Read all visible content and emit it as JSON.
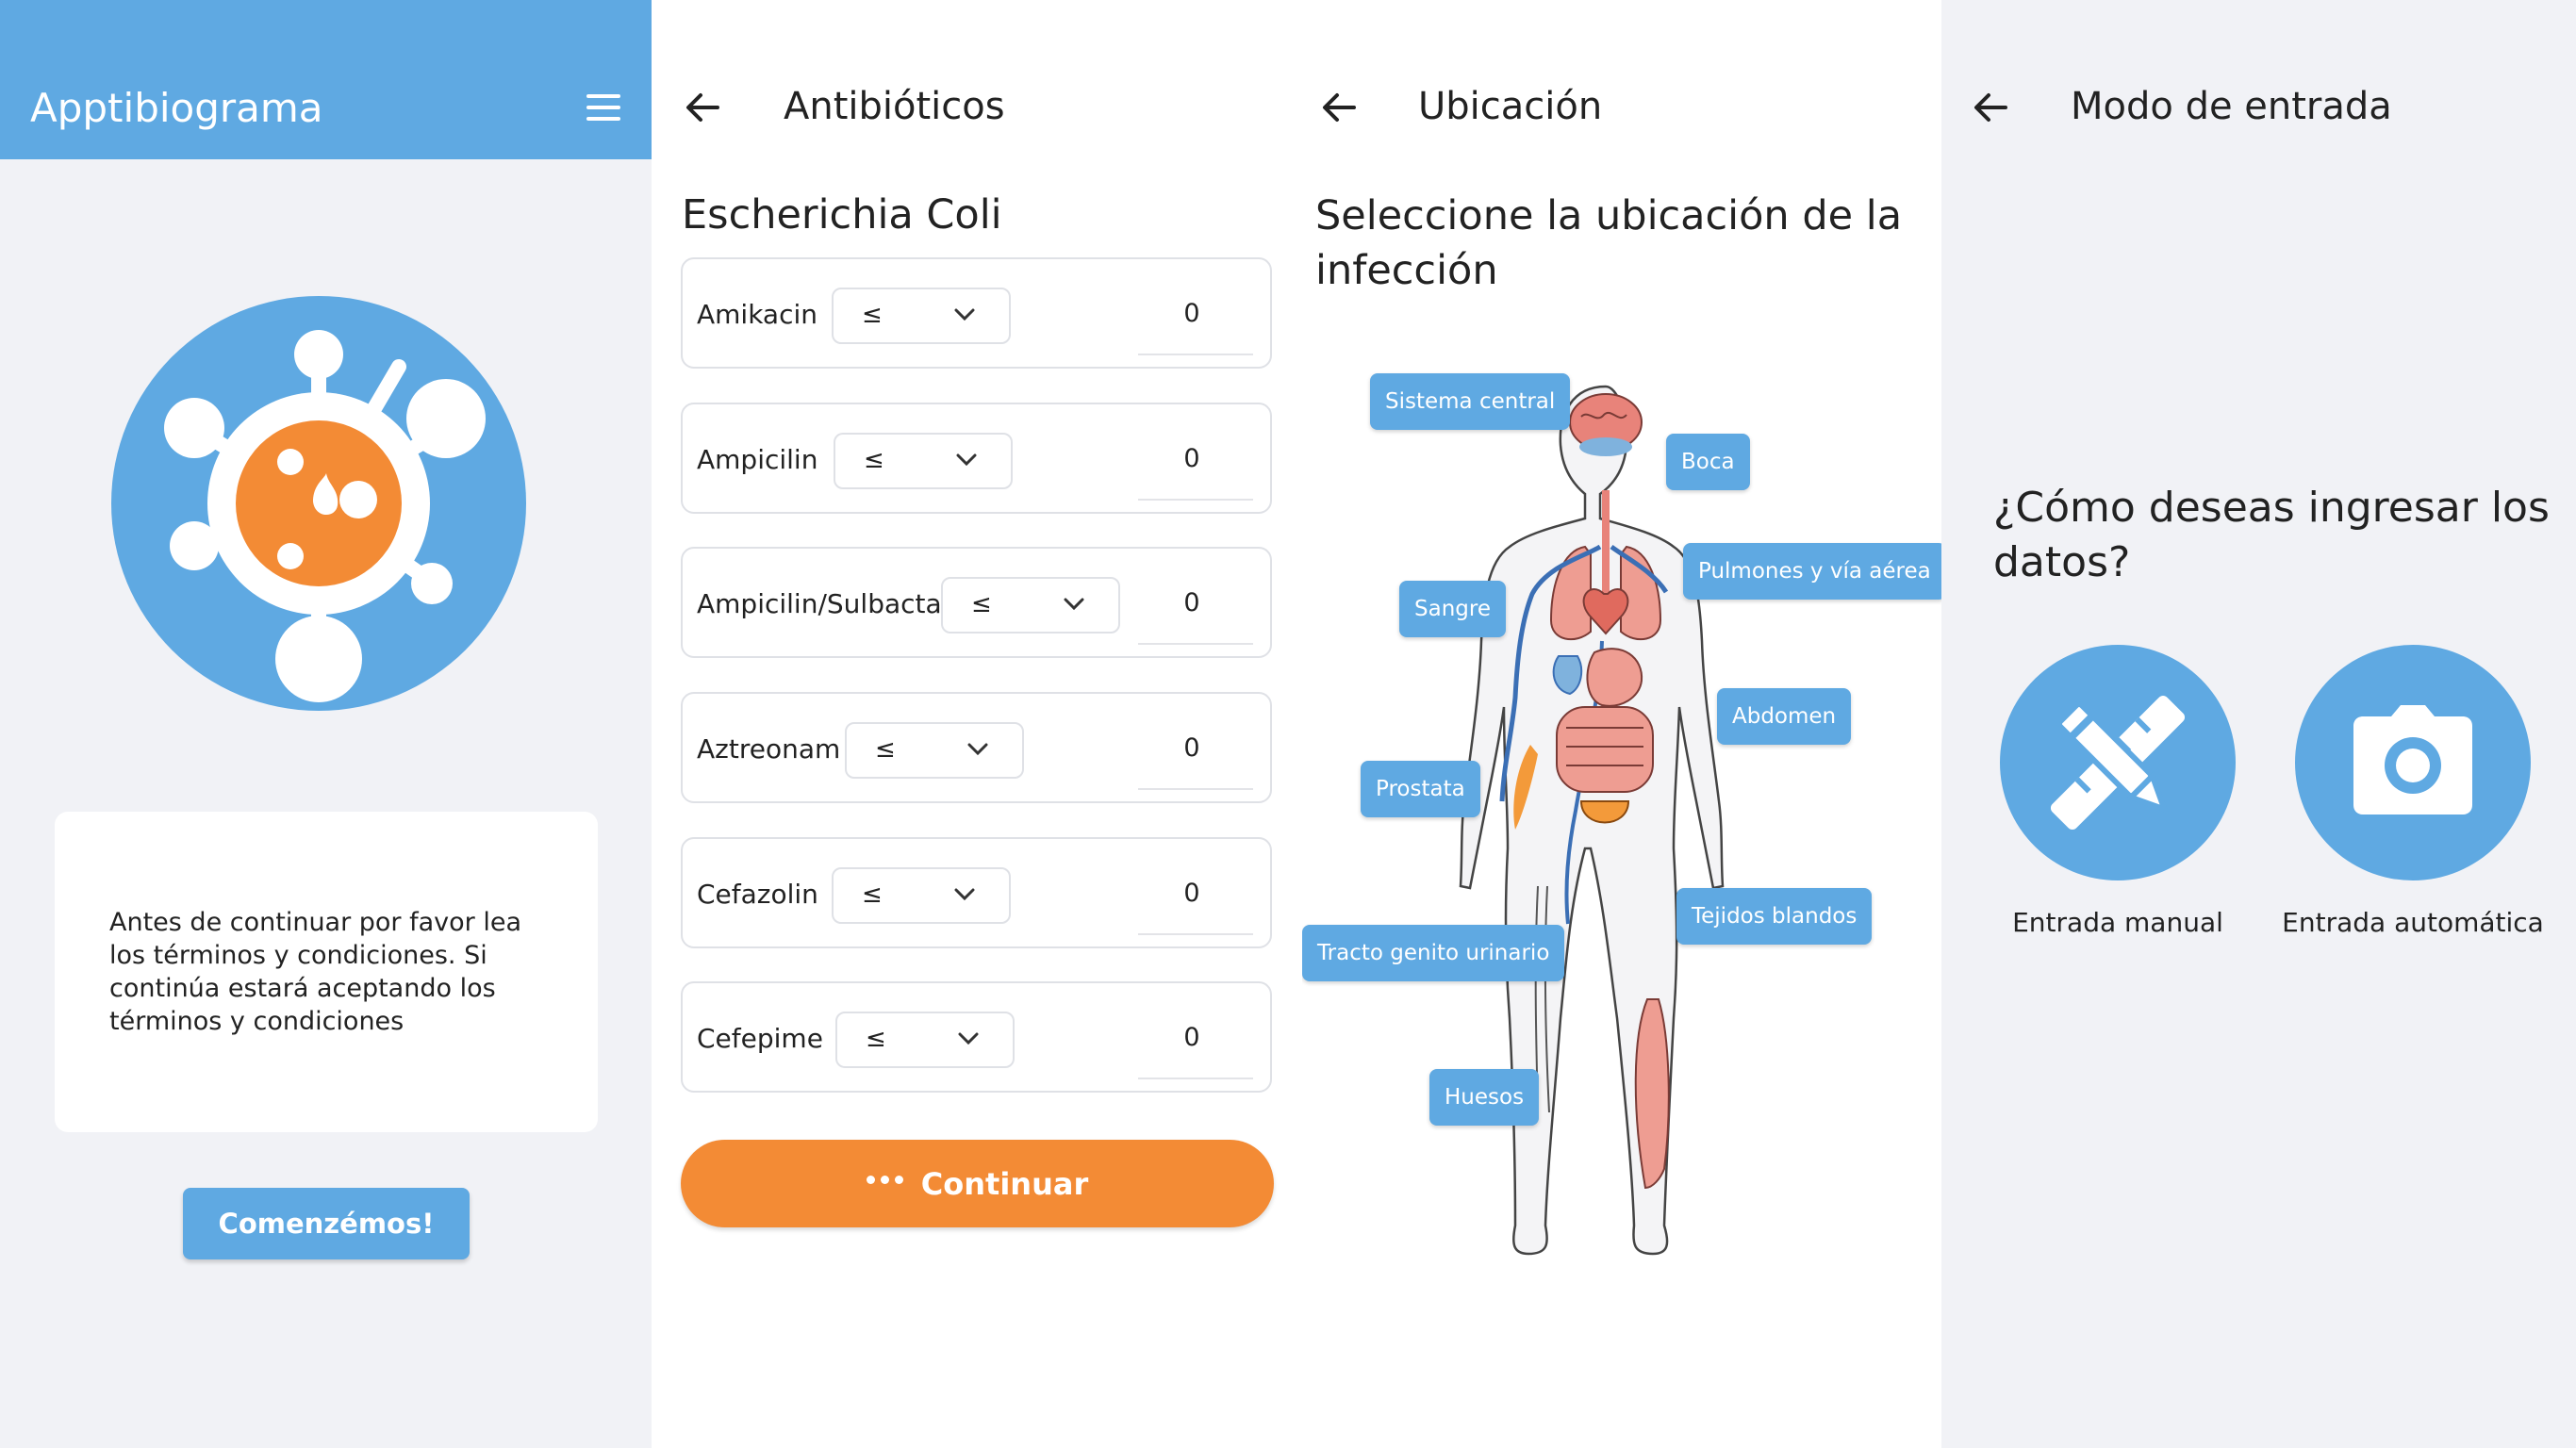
{
  "colors": {
    "primary": "#5fa9e2",
    "accent": "#f38b35",
    "background": "#f1f2f6"
  },
  "welcome": {
    "app_title": "Apptibiograma",
    "menu_icon": "hamburger-menu-icon",
    "logo_icon": "bacteria-logo-icon",
    "terms_text": "Antes de continuar por favor lea los términos y condiciones. Si continúa estará aceptando los términos y condiciones",
    "start_button": "Comenzémos!"
  },
  "antibiotics": {
    "title": "Antibióticos",
    "back_icon": "arrow-left-icon",
    "organism": "Escherichia Coli",
    "items": [
      {
        "name": "Amikacin",
        "operator": "≤",
        "value": "0"
      },
      {
        "name": "Ampicilin",
        "operator": "≤",
        "value": "0"
      },
      {
        "name": "Ampicilin/Sulbactan",
        "operator": "≤",
        "value": "0"
      },
      {
        "name": "Aztreonam",
        "operator": "≤",
        "value": "0"
      },
      {
        "name": "Cefazolin",
        "operator": "≤",
        "value": "0"
      },
      {
        "name": "Cefepime",
        "operator": "≤",
        "value": "0"
      }
    ],
    "continue_button": "Continuar",
    "continue_icon": "more-dots-icon"
  },
  "location": {
    "title": "Ubicación",
    "back_icon": "arrow-left-icon",
    "prompt": "Seleccione la ubicación de la infección",
    "illustration": "human-anatomy-illustration",
    "tags": {
      "sistema_central": "Sistema central",
      "boca": "Boca",
      "pulmones": "Pulmones y vía aérea",
      "sangre": "Sangre",
      "abdomen": "Abdomen",
      "prostata": "Prostata",
      "tejidos": "Tejidos blandos",
      "tracto": "Tracto genito urinario",
      "huesos": "Huesos"
    }
  },
  "entry_mode": {
    "title": "Modo de entrada",
    "back_icon": "arrow-left-icon",
    "question": "¿Cómo deseas ingresar los datos?",
    "manual_label": "Entrada manual",
    "manual_icon": "pencil-ruler-icon",
    "auto_label": "Entrada automática",
    "auto_icon": "camera-icon"
  }
}
